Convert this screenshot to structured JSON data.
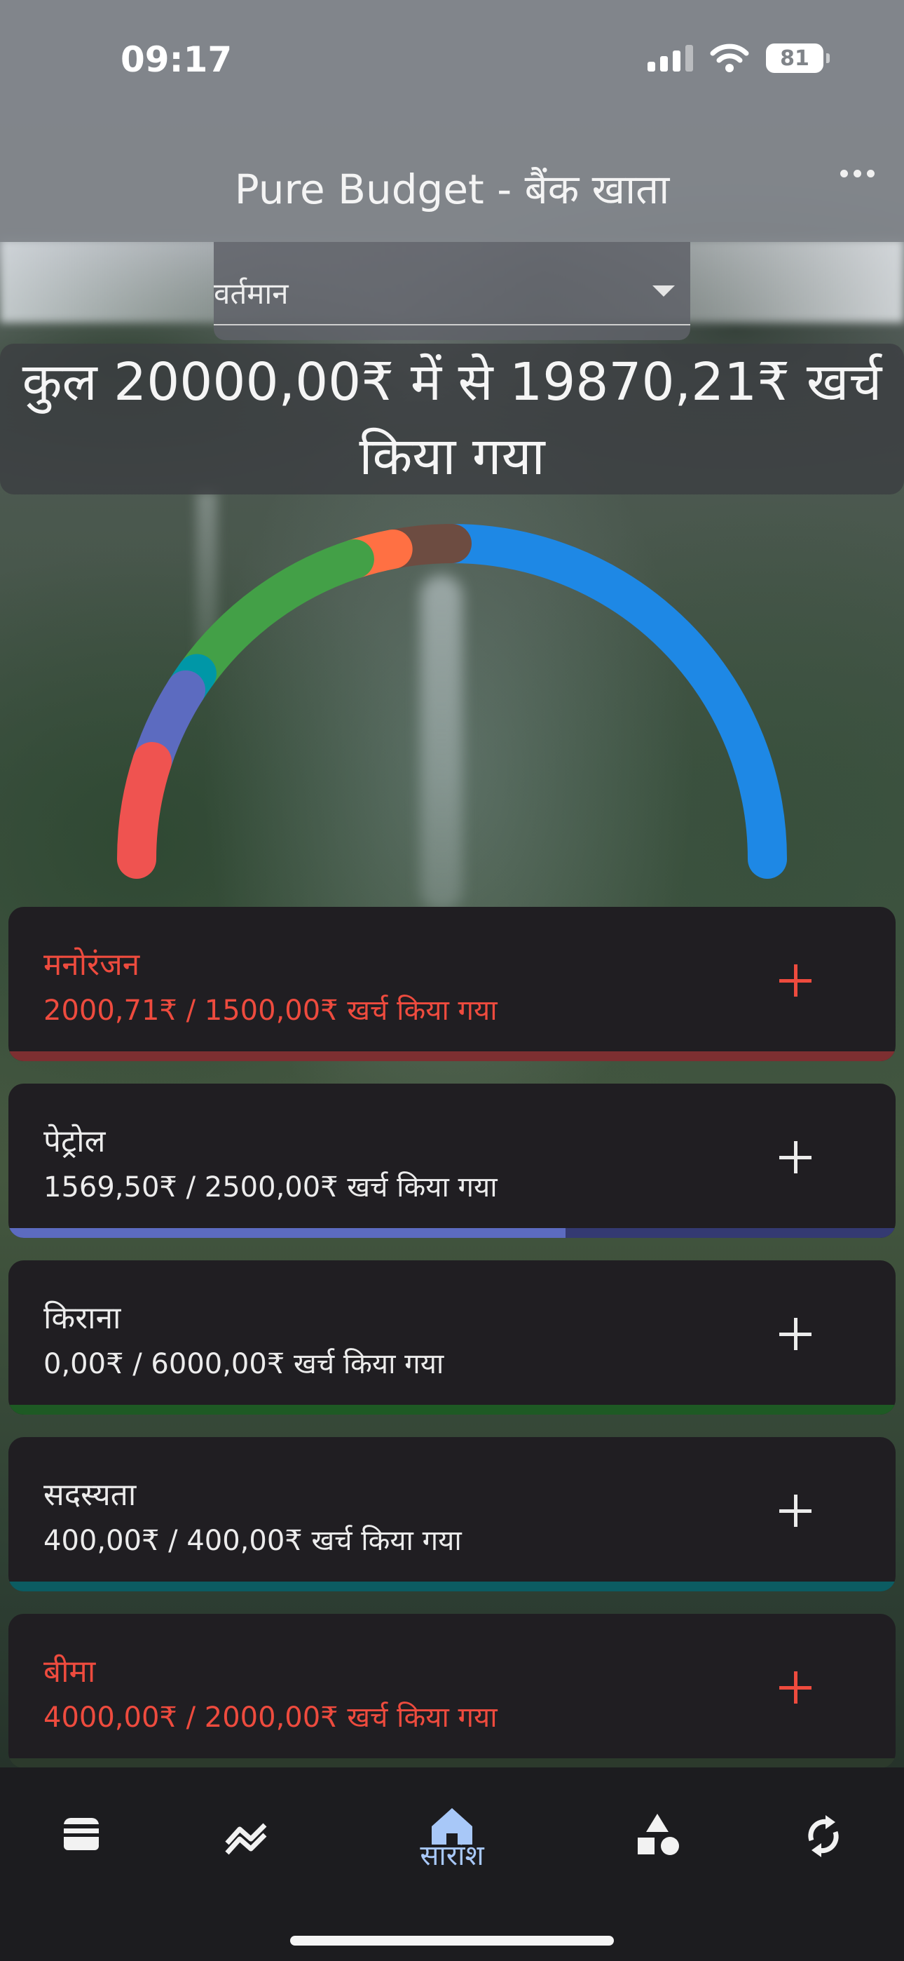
{
  "status_bar": {
    "time": "09:17",
    "battery": "81"
  },
  "header": {
    "title": "Pure Budget - बैंक खाता"
  },
  "period": {
    "selected": "वर्तमान"
  },
  "summary": {
    "text": "कुल 20000,00₹ में से 19870,21₹ खर्च किया गया",
    "total": 20000.0,
    "spent": 19870.21
  },
  "gauge": {
    "segments": [
      {
        "category": "मनोरंजन",
        "color": "#ef5350",
        "share": 0.1
      },
      {
        "category": "पेट्रोल",
        "color": "#5c6bc0",
        "share": 0.08
      },
      {
        "category": "सदस्यता",
        "color": "#0097a7",
        "share": 0.02
      },
      {
        "category": "किराना",
        "color": "#43a047",
        "share": 0.2
      },
      {
        "category": "orange",
        "color": "#ff7043",
        "share": 0.04
      },
      {
        "category": "brown",
        "color": "#6d4c41",
        "share": 0.06
      },
      {
        "category": "बीमा",
        "color": "#1e88e5",
        "share": 0.5
      }
    ]
  },
  "categories": [
    {
      "name": "मनोरंजन",
      "amount": "2000,71₹ / 1500,00₹ खर्च किया गया",
      "over": true,
      "progress": 1.0,
      "track": "#5a2a2c",
      "fill": "#7d2f31"
    },
    {
      "name": "पेट्रोल",
      "amount": "1569,50₹ / 2500,00₹ खर्च किया गया",
      "over": false,
      "progress": 0.628,
      "track": "#343a72",
      "fill": "#5c6bc0"
    },
    {
      "name": "किराना",
      "amount": "0,00₹ / 6000,00₹ खर्च किया गया",
      "over": false,
      "progress": 0.0,
      "track": "#1e5a24",
      "fill": "#43a047"
    },
    {
      "name": "सदस्यता",
      "amount": "400,00₹ / 400,00₹ खर्च किया गया",
      "over": false,
      "progress": 1.0,
      "track": "#0c5c62",
      "fill": "#0c5c62"
    },
    {
      "name": "बीमा",
      "amount": "4000,00₹ / 2000,00₹ खर्च किया गया",
      "over": true,
      "progress": 1.0,
      "track": "#2c3a2c",
      "fill": "#2c3a2c"
    }
  ],
  "nav": {
    "items": [
      {
        "icon": "wallet-icon"
      },
      {
        "icon": "trend-icon"
      },
      {
        "icon": "home-icon",
        "label": "सारांश",
        "active": true
      },
      {
        "icon": "shapes-icon"
      },
      {
        "icon": "sync-icon"
      }
    ],
    "active_color": "#a8c8f8"
  }
}
